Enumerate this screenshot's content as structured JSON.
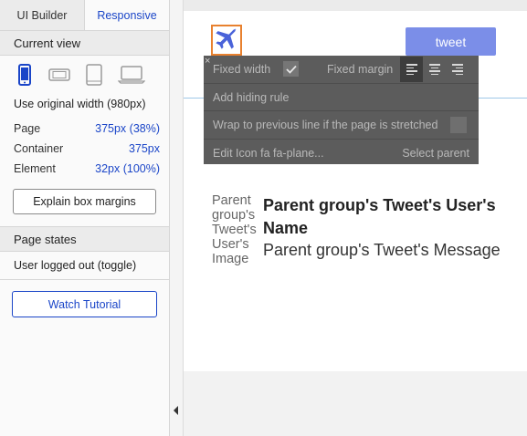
{
  "tabs": {
    "ui_builder": "UI Builder",
    "responsive": "Responsive"
  },
  "current_view": {
    "title": "Current view",
    "devices": [
      "mobile-portrait-icon",
      "mobile-landscape-icon",
      "tablet-icon",
      "laptop-icon"
    ],
    "use_original": "Use original width (980px)",
    "rows": [
      {
        "label": "Page",
        "value": "375px (38%)"
      },
      {
        "label": "Container",
        "value": "375px"
      },
      {
        "label": "Element",
        "value": "32px (100%)"
      }
    ],
    "explain_button": "Explain box margins"
  },
  "page_states": {
    "title": "Page states",
    "item": "User logged out (toggle)",
    "tutorial_button": "Watch Tutorial"
  },
  "canvas": {
    "tweet_button": "tweet",
    "image_label": "Parent group's Tweet's User's Image",
    "user_name": "Parent group's Tweet's User's Name",
    "message": "Parent group's Tweet's Message"
  },
  "popup": {
    "close": "×",
    "fixed_width": "Fixed width",
    "fixed_margin": "Fixed margin",
    "add_hiding_rule": "Add hiding rule",
    "wrap": "Wrap to previous line if the page is stretched",
    "edit_icon": "Edit Icon fa fa-plane...",
    "select_parent": "Select parent"
  },
  "colors": {
    "accent_blue": "#1a45c8",
    "tweet_button": "#7b8ee8",
    "selection_orange": "#e8812f",
    "plane_icon": "#4a63d9",
    "popup_bg": "#5c5c5c"
  }
}
